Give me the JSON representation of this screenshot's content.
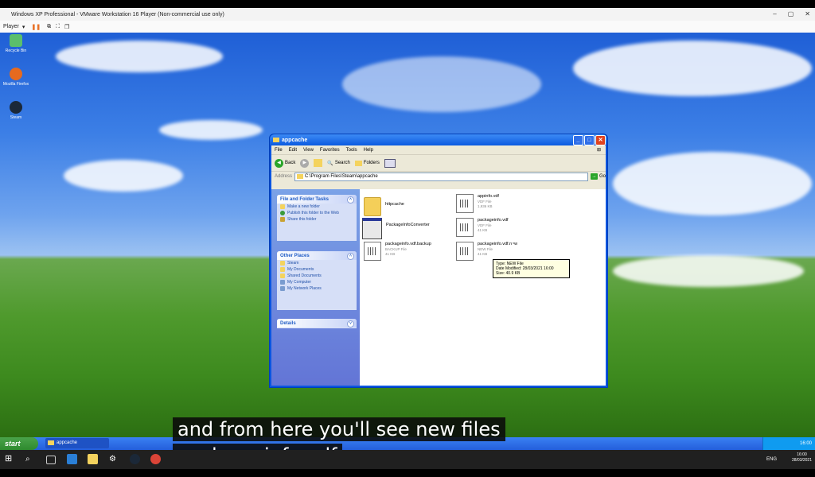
{
  "vm": {
    "title": "Windows XP Professional - VMware Workstation 16 Player (Non-commercial use only)",
    "player_menu": "Player"
  },
  "desktop_icons": [
    {
      "label": "Recycle Bin"
    },
    {
      "label": "Mozilla Firefox"
    },
    {
      "label": "Steam"
    }
  ],
  "explorer": {
    "title": "appcache",
    "menu": [
      "File",
      "Edit",
      "View",
      "Favorites",
      "Tools",
      "Help"
    ],
    "toolbar": {
      "back": "Back",
      "search": "Search",
      "folders": "Folders"
    },
    "address_label": "Address",
    "address": "C:\\Program Files\\Steam\\appcache",
    "go": "Go",
    "task_panes": {
      "file_folder_tasks": {
        "title": "File and Folder Tasks",
        "items": [
          "Make a new folder",
          "Publish this folder to the Web",
          "Share this folder"
        ]
      },
      "other_places": {
        "title": "Other Places",
        "items": [
          "Steam",
          "My Documents",
          "Shared Documents",
          "My Computer",
          "My Network Places"
        ]
      },
      "details": {
        "title": "Details"
      }
    },
    "files": [
      {
        "name": "httpcache",
        "type": "",
        "size": ""
      },
      {
        "name": "appinfo.vdf",
        "type": "VDF File",
        "size": "1,936 KB"
      },
      {
        "name": "PackageInfoConverter",
        "type": "",
        "size": ""
      },
      {
        "name": "packageinfo.vdf",
        "type": "VDF File",
        "size": "41 KB"
      },
      {
        "name": "packageinfo.vdf.backup",
        "type": "BACKUP File",
        "size": "41 KB"
      },
      {
        "name": "packageinfo.vdf.new",
        "type": "NEW File",
        "size": "41 KB"
      }
    ],
    "tooltip": {
      "line1": "Type: NEW File",
      "line2": "Date Modified: 28/03/2021 16:00",
      "line3": "Size: 40.9 KB"
    }
  },
  "xp_taskbar": {
    "start": "start",
    "task": "appcache",
    "tray_time": "16:00"
  },
  "captions": [
    "and from here you'll see new files",
    "package info pdf"
  ],
  "win10_tray": {
    "lang": "ENG",
    "time": "16:00",
    "date": "28/03/2021"
  }
}
